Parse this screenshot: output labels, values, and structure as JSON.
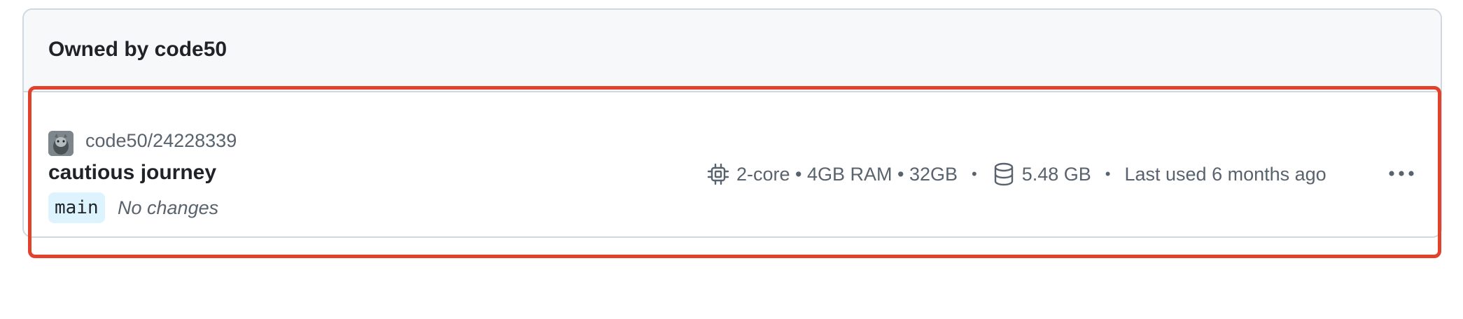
{
  "section": {
    "title": "Owned by code50"
  },
  "codespace": {
    "repository": "code50/24228339",
    "name": "cautious journey",
    "branch": "main",
    "changes": "No changes",
    "machine": "2-core • 4GB RAM • 32GB",
    "separator": "•",
    "storage": "5.48 GB",
    "last_used": "Last used 6 months ago"
  },
  "icons": {
    "cpu": "cpu-icon",
    "storage": "database-icon",
    "more": "kebab-horizontal-icon"
  },
  "colors": {
    "highlight": "#e2412b",
    "branch_bg": "#ddf4ff",
    "header_bg": "#f6f8fa",
    "muted_text": "#59636e"
  }
}
